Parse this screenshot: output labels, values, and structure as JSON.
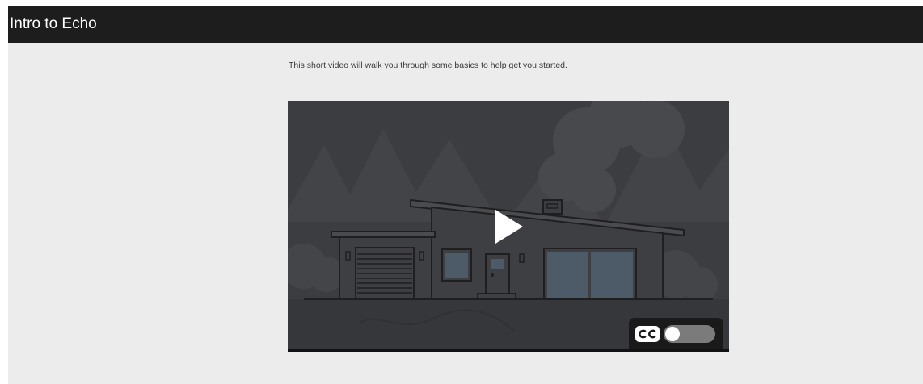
{
  "header": {
    "title": "Intro to Echo"
  },
  "main": {
    "intro_text": "This short video will walk you through some basics to help get you started."
  },
  "video": {
    "play_icon": "play-icon",
    "captions": {
      "icon_label": "CC",
      "enabled": false
    }
  },
  "colors": {
    "header_bg": "#1d1d1d",
    "panel_bg": "#ececec",
    "video_bg": "#3c3d40",
    "house_window": "#4d5a68",
    "toggle_track": "#7b7b7b"
  }
}
